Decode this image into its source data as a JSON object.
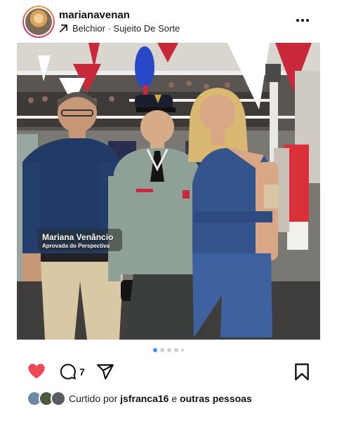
{
  "post": {
    "username": "marianavenan",
    "music": "Belchior · Sujeito De Sorte"
  },
  "photo_caption": {
    "name": "Mariana Venâncio",
    "subtitle": "Aprovada do Perspectiva"
  },
  "carousel": {
    "total": 5,
    "active_index": 0
  },
  "actions": {
    "comment_count": "7"
  },
  "likes": {
    "prefix": "Curtido por",
    "user": "jsfranca16",
    "joiner": "e",
    "others": "outras pessoas"
  },
  "colors": {
    "like_red": "#ed4956",
    "active_dot": "#3897f0"
  }
}
